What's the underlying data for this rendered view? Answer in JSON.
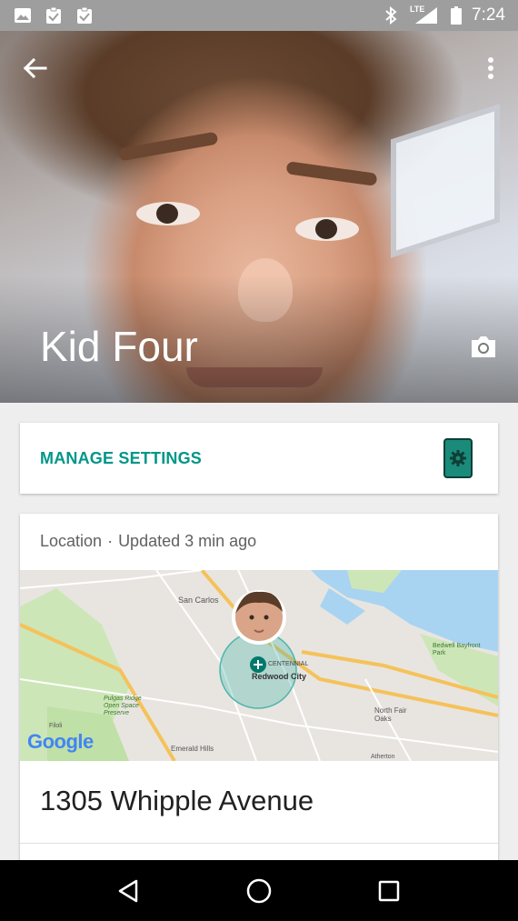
{
  "status_bar": {
    "time": "7:24",
    "network": "LTE",
    "icons": [
      "image-icon",
      "clipboard-check-icon",
      "clipboard-check-icon",
      "bluetooth-icon",
      "signal-icon",
      "battery-icon"
    ]
  },
  "profile": {
    "name": "Kid Four"
  },
  "settings_card": {
    "label": "MANAGE SETTINGS"
  },
  "location_card": {
    "title": "Location",
    "separator": "·",
    "updated": "Updated 3 min ago",
    "address": "1305 Whipple Avenue",
    "map_labels": [
      "San Carlos",
      "Redwood City",
      "CENTENNIAL",
      "North Fair Oaks",
      "Pulgas Ridge Open Space Preserve",
      "Bedwell Bayfront Park",
      "Emerald Hills",
      "Atherton",
      "Filoli",
      "Google"
    ],
    "map_attribution": "Google"
  },
  "colors": {
    "accent": "#009688",
    "status_bar": "#9e9e9e",
    "nav_bar": "#000000"
  }
}
